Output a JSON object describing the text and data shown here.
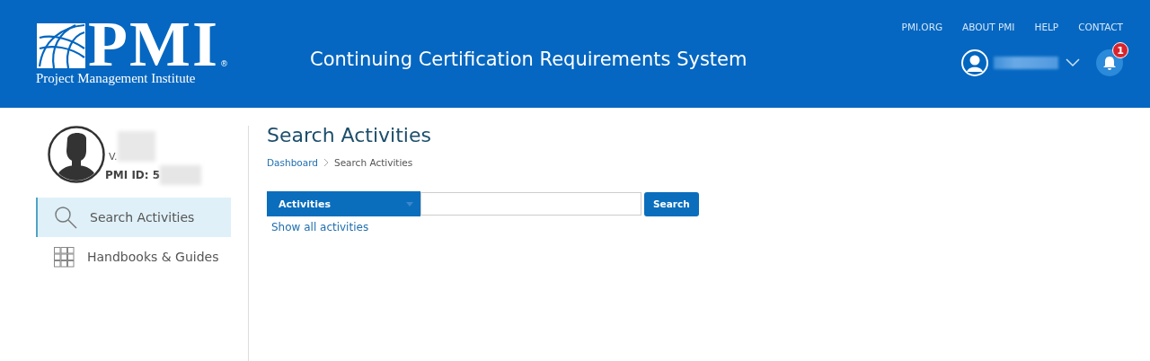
{
  "header": {
    "logo": {
      "mark": "PMI",
      "registered": "®",
      "name": "Project Management Institute"
    },
    "title": "Continuing Certification Requirements System",
    "top_links": [
      "PMI.ORG",
      "ABOUT PMI",
      "HELP",
      "CONTACT"
    ],
    "notifications": {
      "count": "1"
    }
  },
  "profile": {
    "name": "V.",
    "pmi_id": "PMI ID: 5"
  },
  "sidebar": {
    "items": [
      {
        "label": "Search Activities",
        "kind": "search",
        "selected": true
      },
      {
        "label": "Handbooks & Guides",
        "kind": "grid",
        "selected": false
      }
    ]
  },
  "page": {
    "title": "Search Activities",
    "breadcrumb": [
      "Dashboard",
      "Search Activities"
    ],
    "search": {
      "category": "Activities",
      "button": "Search"
    },
    "show_all_link": "Show all activities"
  }
}
